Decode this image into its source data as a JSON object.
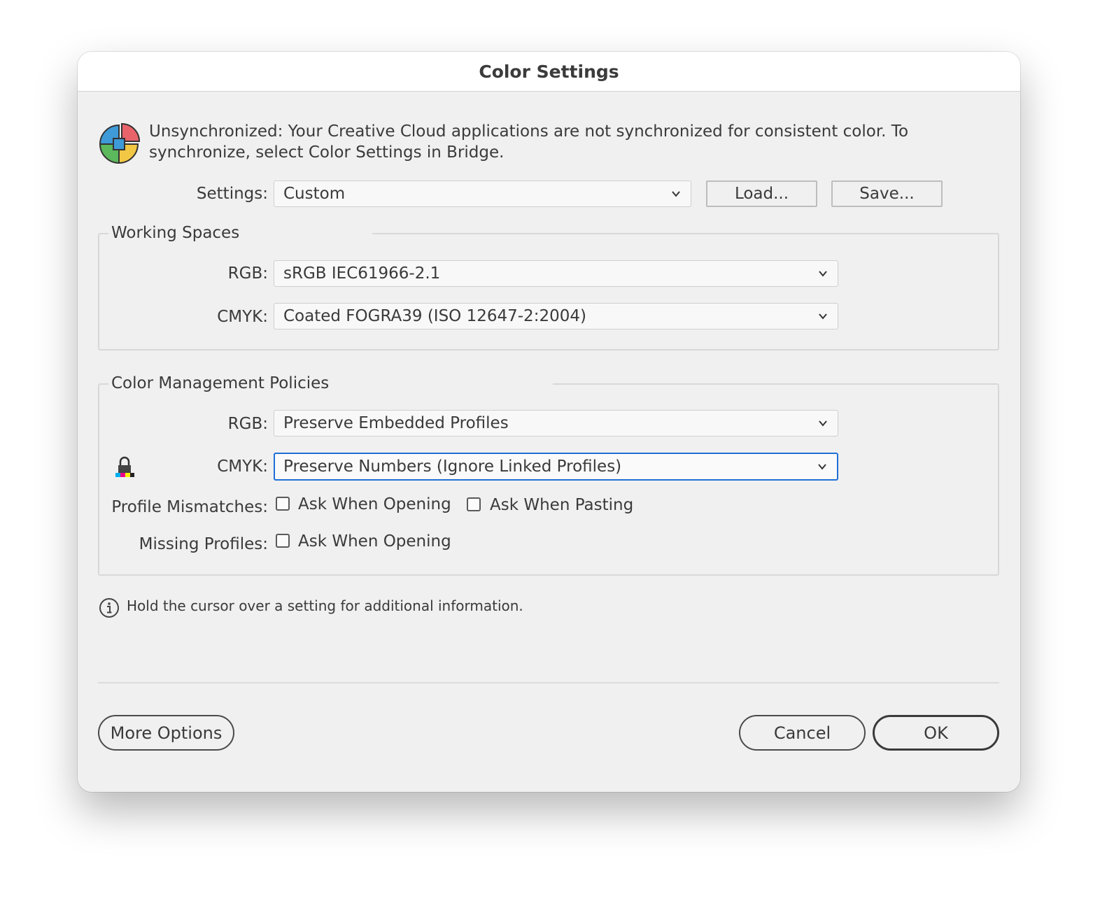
{
  "window": {
    "title": "Color Settings"
  },
  "sync_message": {
    "line1": "Unsynchronized: Your Creative Cloud applications are not synchronized for consistent color. To",
    "line2": "synchronize, select Color Settings in Bridge.",
    "icon": "color-sync-icon"
  },
  "settings": {
    "label": "Settings:",
    "value": "Custom",
    "load_label": "Load...",
    "save_label": "Save..."
  },
  "working_spaces": {
    "legend": "Working Spaces",
    "rgb_label": "RGB:",
    "rgb_value": "sRGB IEC61966-2.1",
    "cmyk_label": "CMYK:",
    "cmyk_value": "Coated FOGRA39 (ISO 12647-2:2004)"
  },
  "policies": {
    "legend": "Color Management Policies",
    "rgb_label": "RGB:",
    "rgb_value": "Preserve Embedded Profiles",
    "cmyk_label": "CMYK:",
    "cmyk_value": "Preserve Numbers (Ignore Linked Profiles)",
    "cmyk_icon": "cmyk-lock-icon",
    "profile_mismatches_label": "Profile Mismatches:",
    "ask_when_opening": "Ask When Opening",
    "ask_when_pasting": "Ask When Pasting",
    "missing_profiles_label": "Missing Profiles:",
    "missing_ask_when_opening": "Ask When Opening",
    "checked": {
      "mismatch_opening": false,
      "mismatch_pasting": false,
      "missing_opening": false
    }
  },
  "info": {
    "text": "Hold the cursor over a setting for additional information.",
    "icon": "info-icon"
  },
  "footer": {
    "more_options": "More Options",
    "cancel": "Cancel",
    "ok": "OK"
  },
  "colors": {
    "focus": "#1f6fd6",
    "dialog_bg": "#f0f0f0"
  }
}
